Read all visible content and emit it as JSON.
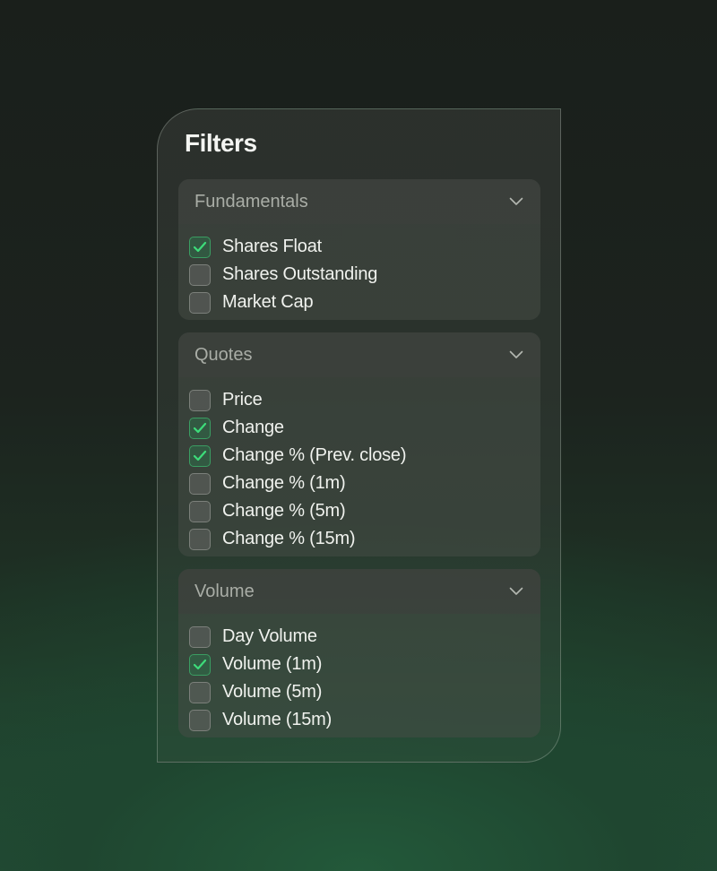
{
  "panel": {
    "title": "Filters",
    "sections": [
      {
        "title": "Fundamentals",
        "icon": "chevron-down-icon",
        "items": [
          {
            "label": "Shares Float",
            "checked": true
          },
          {
            "label": "Shares Outstanding",
            "checked": false
          },
          {
            "label": "Market Cap",
            "checked": false
          }
        ]
      },
      {
        "title": "Quotes",
        "icon": "chevron-down-icon",
        "items": [
          {
            "label": "Price",
            "checked": false
          },
          {
            "label": "Change",
            "checked": true
          },
          {
            "label": "Change % (Prev. close)",
            "checked": true
          },
          {
            "label": "Change % (1m)",
            "checked": false
          },
          {
            "label": "Change % (5m)",
            "checked": false
          },
          {
            "label": "Change % (15m)",
            "checked": false
          }
        ]
      },
      {
        "title": "Volume",
        "icon": "chevron-down-icon",
        "items": [
          {
            "label": "Day Volume",
            "checked": false
          },
          {
            "label": "Volume (1m)",
            "checked": true
          },
          {
            "label": "Volume (5m)",
            "checked": false
          },
          {
            "label": "Volume (15m)",
            "checked": false
          }
        ]
      }
    ]
  },
  "colors": {
    "accent": "#3ddc7a",
    "checkbox_checked_border": "#3a9d62"
  }
}
